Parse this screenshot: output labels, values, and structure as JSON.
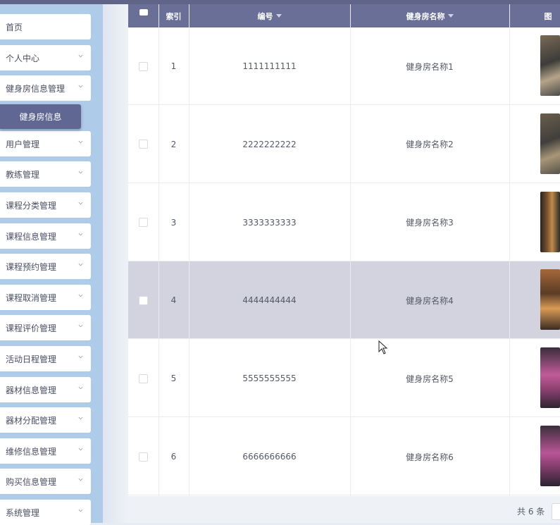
{
  "sidebar": {
    "items": [
      {
        "label": "首页",
        "has_chevron": false
      },
      {
        "label": "个人中心",
        "has_chevron": true
      },
      {
        "label": "健身房信息管理",
        "has_chevron": true
      },
      {
        "label": "用户管理",
        "has_chevron": true
      },
      {
        "label": "教练管理",
        "has_chevron": true
      },
      {
        "label": "课程分类管理",
        "has_chevron": true
      },
      {
        "label": "课程信息管理",
        "has_chevron": true
      },
      {
        "label": "课程预约管理",
        "has_chevron": true
      },
      {
        "label": "课程取消管理",
        "has_chevron": true
      },
      {
        "label": "课程评价管理",
        "has_chevron": true
      },
      {
        "label": "活动日程管理",
        "has_chevron": true
      },
      {
        "label": "器材信息管理",
        "has_chevron": true
      },
      {
        "label": "器材分配管理",
        "has_chevron": true
      },
      {
        "label": "维修信息管理",
        "has_chevron": true
      },
      {
        "label": "购买信息管理",
        "has_chevron": true
      },
      {
        "label": "系统管理",
        "has_chevron": true
      }
    ],
    "active_sub": "健身房信息"
  },
  "table": {
    "headers": {
      "index": "索引",
      "number": "编号",
      "name": "健身房名称",
      "image": "图"
    },
    "rows": [
      {
        "index": "1",
        "number": "1111111111",
        "name": "健身房名称1",
        "highlighted": false
      },
      {
        "index": "2",
        "number": "2222222222",
        "name": "健身房名称2",
        "highlighted": false
      },
      {
        "index": "3",
        "number": "3333333333",
        "name": "健身房名称3",
        "highlighted": false
      },
      {
        "index": "4",
        "number": "4444444444",
        "name": "健身房名称4",
        "highlighted": true
      },
      {
        "index": "5",
        "number": "5555555555",
        "name": "健身房名称5",
        "highlighted": false
      },
      {
        "index": "6",
        "number": "6666666666",
        "name": "健身房名称6",
        "highlighted": false
      }
    ]
  },
  "footer": {
    "total": "共 6 条"
  },
  "colors": {
    "header_bg": "#6a6f97",
    "active_sub_bg": "#5f6792",
    "sidebar_bg": "#aecbe9",
    "highlight_row": "#d2d3df"
  }
}
